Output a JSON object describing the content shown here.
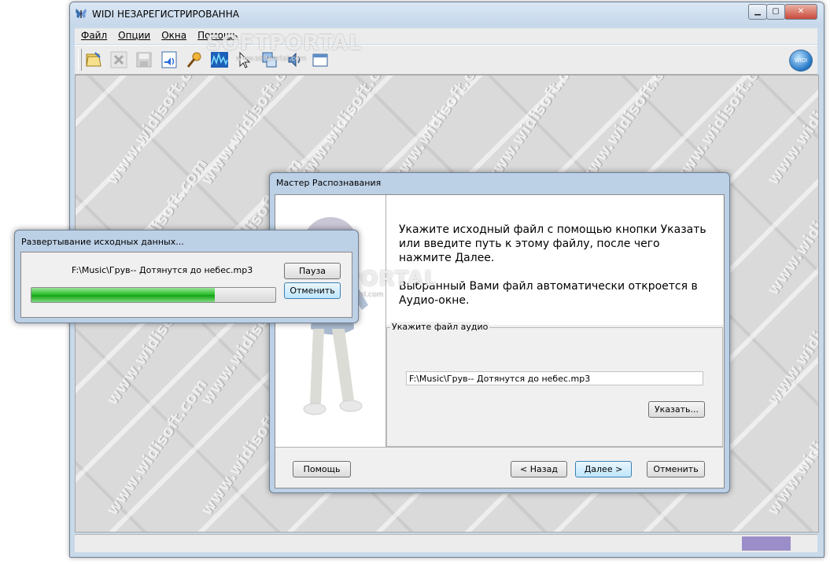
{
  "window": {
    "title": "WIDI НЕЗАРЕГИСТРИРОВАННА",
    "min_symbol": "▁",
    "max_symbol": "▢",
    "close_symbol": "✕"
  },
  "menu": [
    "Файл",
    "Опции",
    "Окна",
    "Помощь"
  ],
  "toolbar": {
    "icons": [
      "open-wizard-icon",
      "close-icon",
      "save-icon",
      "audio-file-icon",
      "microphone-icon",
      "spectrum-icon",
      "cursor-icon",
      "layers-icon",
      "speaker-icon",
      "window-icon"
    ],
    "globe_label": "WIDI"
  },
  "watermark": {
    "brand": "www.widisoft.com",
    "portal": "SOFTPORTAL",
    "portal_url": "www.softportal.com"
  },
  "wizard": {
    "title": "Мастер Распознавания",
    "instruction": "Укажите исходный файл с помощью кнопки Указать или введите путь к этому файлу, после чего нажмите Далее.",
    "note": "Выбранный Вами файл автоматически откроется в Аудио-окне.",
    "group_label": "Укажите файл аудио",
    "file_path": "F:\\Music\\Грув-- Дотянутся до небес.mp3",
    "browse_button": "Указать...",
    "help_button": "Помощь",
    "back_button": "< Назад",
    "next_button": "Далее >",
    "cancel_button": "Отменить"
  },
  "progress_dialog": {
    "title": "Развертывание исходных данных...",
    "file": "F:\\Music\\Грув-- Дотянутся до небес.mp3",
    "progress": 0.75,
    "pause_button": "Пауза",
    "cancel_button": "Отменить"
  },
  "colors": {
    "progress_green": "#2fbf2f",
    "status_panel": "#9b8ec8",
    "frame": "#bcd0e6"
  }
}
